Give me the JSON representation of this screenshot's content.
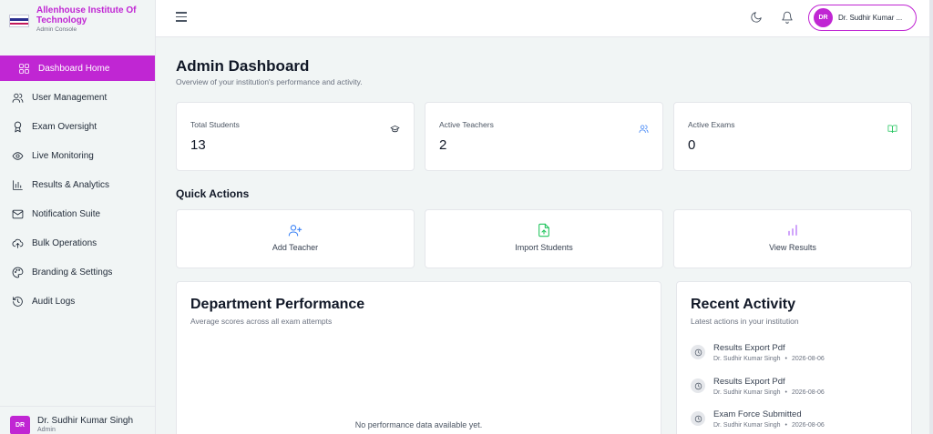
{
  "brand": {
    "name": "Allenhouse Institute Of Technology",
    "subtitle": "Admin Console"
  },
  "sidebar": {
    "items": [
      {
        "label": "Dashboard Home",
        "icon": "grid-icon",
        "active": true
      },
      {
        "label": "User Management",
        "icon": "users-icon"
      },
      {
        "label": "Exam Oversight",
        "icon": "award-icon"
      },
      {
        "label": "Live Monitoring",
        "icon": "eye-icon"
      },
      {
        "label": "Results & Analytics",
        "icon": "bar-chart-icon"
      },
      {
        "label": "Notification Suite",
        "icon": "mail-icon"
      },
      {
        "label": "Bulk Operations",
        "icon": "cloud-upload-icon"
      },
      {
        "label": "Branding & Settings",
        "icon": "palette-icon"
      },
      {
        "label": "Audit Logs",
        "icon": "history-icon"
      }
    ],
    "user": {
      "initials": "DR",
      "name": "Dr. Sudhir Kumar Singh",
      "role": "Admin"
    }
  },
  "topbar": {
    "user_initials": "DR",
    "user_name": "Dr. Sudhir Kumar ..."
  },
  "page": {
    "title": "Admin Dashboard",
    "subtitle": "Overview of your institution's performance and activity."
  },
  "stats": [
    {
      "label": "Total Students",
      "value": "13",
      "icon": "graduation-cap-icon",
      "color": "#1f2937"
    },
    {
      "label": "Active Teachers",
      "value": "2",
      "icon": "users-icon",
      "color": "#3b82f6"
    },
    {
      "label": "Active Exams",
      "value": "0",
      "icon": "book-open-icon",
      "color": "#22c55e"
    }
  ],
  "quick_actions": {
    "title": "Quick Actions",
    "items": [
      {
        "label": "Add Teacher",
        "icon": "user-plus-icon",
        "color": "#3b82f6"
      },
      {
        "label": "Import Students",
        "icon": "file-upload-icon",
        "color": "#22c55e"
      },
      {
        "label": "View Results",
        "icon": "bar-chart-icon",
        "color": "#a855f7"
      }
    ]
  },
  "department": {
    "title": "Department Performance",
    "subtitle": "Average scores across all exam attempts",
    "empty": "No performance data available yet."
  },
  "recent": {
    "title": "Recent Activity",
    "subtitle": "Latest actions in your institution",
    "items": [
      {
        "title": "Results Export Pdf",
        "user": "Dr. Sudhir Kumar Singh",
        "sep": "•",
        "date": "2026-08-06"
      },
      {
        "title": "Results Export Pdf",
        "user": "Dr. Sudhir Kumar Singh",
        "sep": "•",
        "date": "2026-08-06"
      },
      {
        "title": "Exam Force Submitted",
        "user": "Dr. Sudhir Kumar Singh",
        "sep": "•",
        "date": "2026-08-06"
      }
    ]
  },
  "colors": {
    "accent": "#c026d3"
  }
}
